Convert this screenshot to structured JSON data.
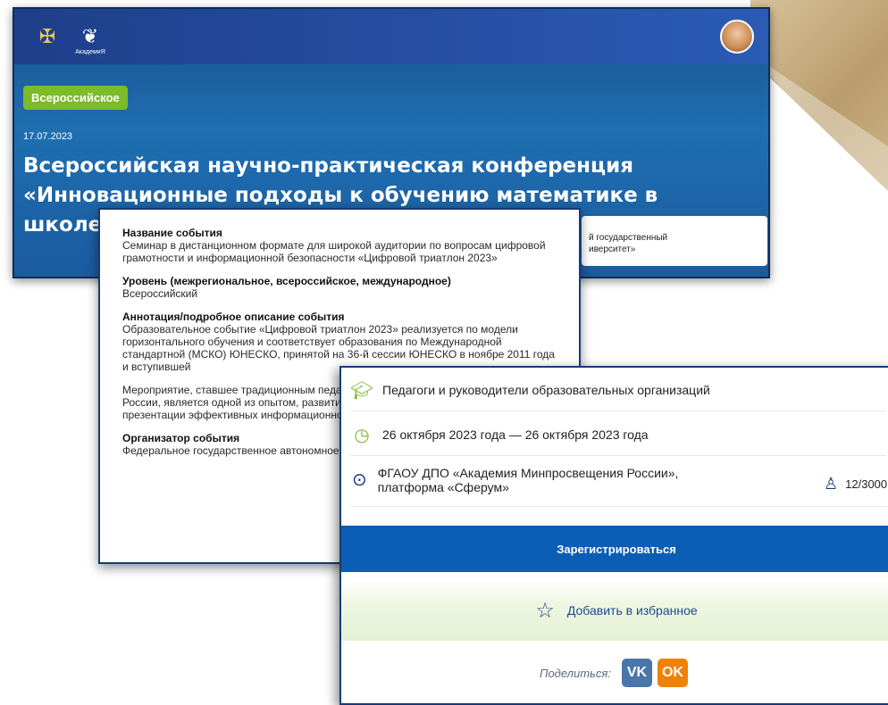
{
  "colors": {
    "banner_blue": "#1f6fb1",
    "badge_green": "#7cbb2a",
    "register_blue": "#0b5db5",
    "vk_blue": "#4a76a8",
    "ok_orange": "#ee8208"
  },
  "banner": {
    "logo_small_text": "АкадемиЯ",
    "badge": "Всероссийское",
    "date": "17.07.2023",
    "title": "Всероссийская научно-практическая конференция «Инновационные подходы к обучению математике в школе и вузе»",
    "card_line1": "й государственный",
    "card_line2": "иверситет»"
  },
  "description": {
    "sections": [
      {
        "heading": "Название события",
        "text": "Семинар в дистанционном формате для широкой аудитории по вопросам цифровой грамотности и информационной безопасности «Цифровой триатлон 2023»"
      },
      {
        "heading": "Уровень (межрегиональное, всероссийское, международное)",
        "text": "Всероссийский"
      },
      {
        "heading": "Аннотация/подробное описание события",
        "text": "Образовательное событие «Цифровой триатлон 2023» реализуется по модели горизонтального обучения и соответствует образования по Международной стандартной (МСКО) ЮНЕСКО, принятой на 36-й сессии ЮНЕСКО в ноябре 2011 года и вступившей"
      },
      {
        "heading": "",
        "text": "Мероприятие, ставшее традиционным педагогов, руководителей и экспертов регионов России, является одной из опытом, развитию профессиональных грамотности и презентации эффективных информационной безопасности."
      },
      {
        "heading": "Организатор события",
        "text": "Федеральное государственное автономное"
      }
    ]
  },
  "event": {
    "audience": "Педагоги и руководители образовательных организаций",
    "dates": "26 октября 2023 года — 26 октября 2023 года",
    "location": "ФГАОУ ДПО «Академия Минпросвещения России», платформа «Сферум»",
    "seats": "12/3000",
    "register_label": "Зарегистрироваться",
    "favorite_label": "Добавить в избранное",
    "share_label": "Поделиться:",
    "vk_label": "VK",
    "ok_label": "OK"
  },
  "icons": [
    "emblem-icon",
    "academy-logo-icon",
    "avatar",
    "graduation-cap-icon",
    "clock-icon",
    "location-pin-icon",
    "person-icon",
    "star-icon"
  ]
}
